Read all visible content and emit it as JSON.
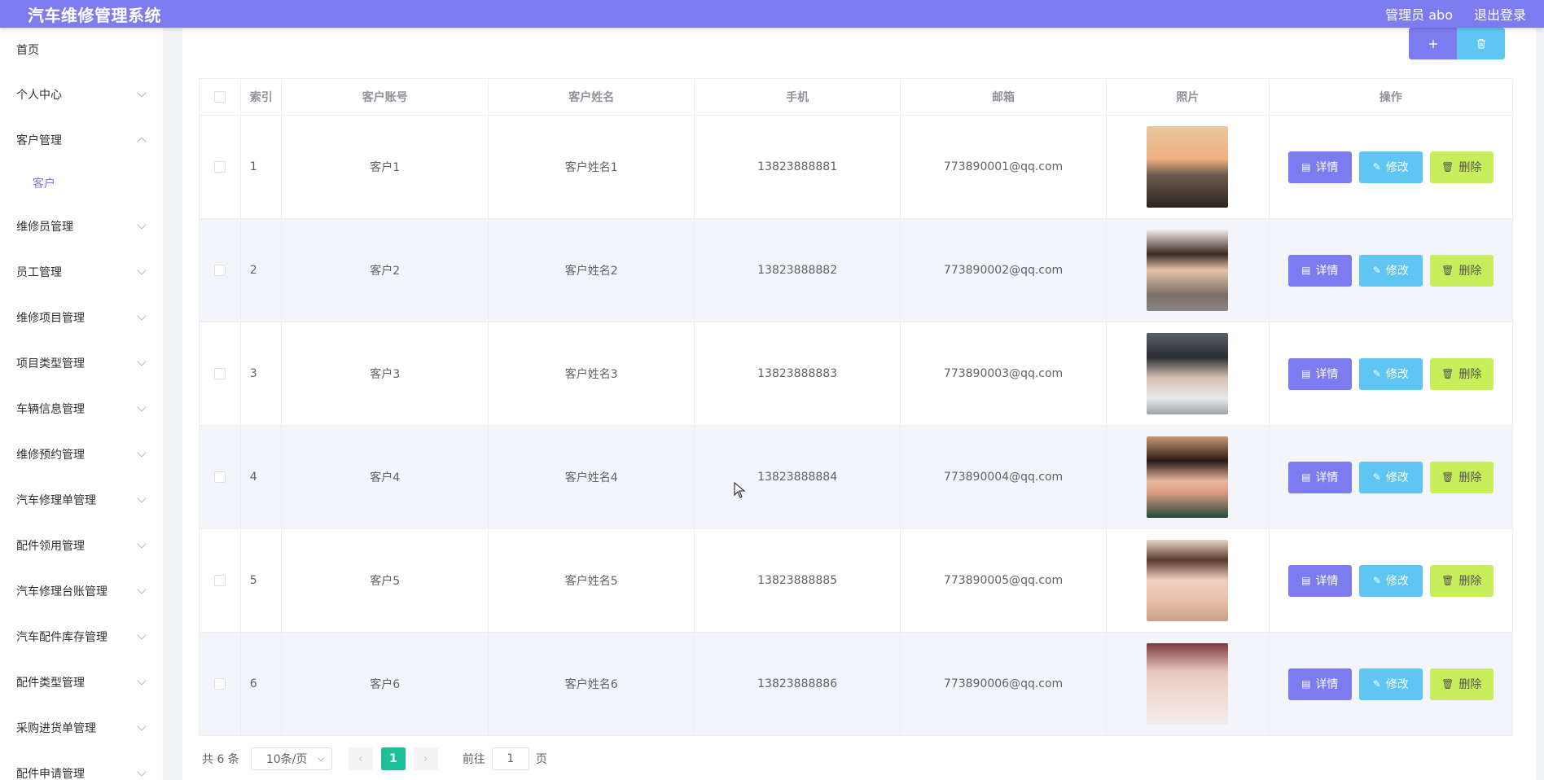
{
  "header": {
    "title": "汽车维修管理系统",
    "user": "管理员 abo",
    "logout": "退出登录"
  },
  "sidebar": {
    "items": [
      {
        "label": "首页"
      },
      {
        "label": "个人中心"
      },
      {
        "label": "客户管理"
      },
      {
        "label": "客户"
      },
      {
        "label": "维修员管理"
      },
      {
        "label": "员工管理"
      },
      {
        "label": "维修项目管理"
      },
      {
        "label": "项目类型管理"
      },
      {
        "label": "车辆信息管理"
      },
      {
        "label": "维修预约管理"
      },
      {
        "label": "汽车修理单管理"
      },
      {
        "label": "配件领用管理"
      },
      {
        "label": "汽车修理台账管理"
      },
      {
        "label": "汽车配件库存管理"
      },
      {
        "label": "配件类型管理"
      },
      {
        "label": "采购进货单管理"
      },
      {
        "label": "配件申请管理"
      }
    ]
  },
  "toolbar": {
    "add_icon": "plus-icon",
    "delete_icon": "trash-icon"
  },
  "table": {
    "headers": [
      "索引",
      "客户账号",
      "客户姓名",
      "手机",
      "邮箱",
      "照片",
      "操作"
    ],
    "rows": [
      {
        "index": "1",
        "account": "客户1",
        "name": "客户姓名1",
        "phone": "13823888881",
        "email": "773890001@qq.com"
      },
      {
        "index": "2",
        "account": "客户2",
        "name": "客户姓名2",
        "phone": "13823888882",
        "email": "773890002@qq.com"
      },
      {
        "index": "3",
        "account": "客户3",
        "name": "客户姓名3",
        "phone": "13823888883",
        "email": "773890003@qq.com"
      },
      {
        "index": "4",
        "account": "客户4",
        "name": "客户姓名4",
        "phone": "13823888884",
        "email": "773890004@qq.com"
      },
      {
        "index": "5",
        "account": "客户5",
        "name": "客户姓名5",
        "phone": "13823888885",
        "email": "773890005@qq.com"
      },
      {
        "index": "6",
        "account": "客户6",
        "name": "客户姓名6",
        "phone": "13823888886",
        "email": "773890006@qq.com"
      }
    ],
    "actions": {
      "detail": "详情",
      "edit": "修改",
      "delete": "删除"
    }
  },
  "pagination": {
    "total": "共 6 条",
    "page_size": "10条/页",
    "current": "1",
    "goto_prefix": "前往",
    "goto_value": "1",
    "goto_suffix": "页"
  },
  "colors": {
    "primary": "#7c7bf0",
    "info": "#5fc5f2",
    "warning": "#c8ef5b",
    "success": "#1ec09a"
  }
}
